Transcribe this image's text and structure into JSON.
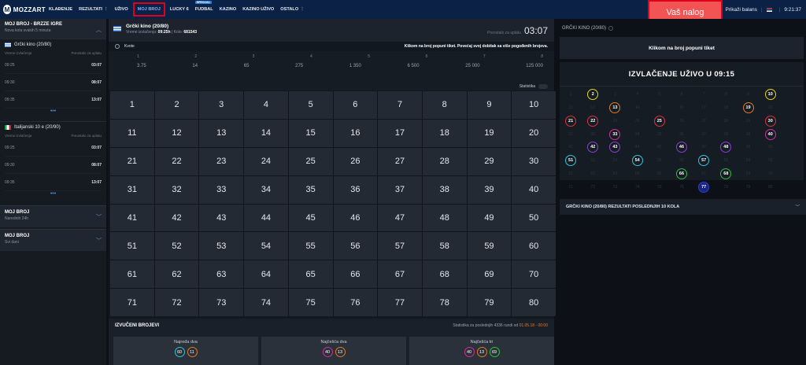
{
  "logo": {
    "text": "MOZZART"
  },
  "nav": [
    {
      "label": "KLAĐENJE",
      "dots": false
    },
    {
      "label": "REZULTATI",
      "dots": true
    },
    {
      "label": "UŽIVO",
      "dots": false
    },
    {
      "label": "MOJ BROJ",
      "dots": false,
      "active": true
    },
    {
      "label": "LUCKY 6",
      "dots": false
    },
    {
      "label": "FUDBAL",
      "dots": false,
      "badge": "SPECIJAL"
    },
    {
      "label": "KAZINO",
      "dots": false
    },
    {
      "label": "KAZINO UŽIVO",
      "dots": false
    },
    {
      "label": "OSTALO",
      "dots": true
    }
  ],
  "account": {
    "label": "Vaš nalog"
  },
  "topright": {
    "balance": "Prikaži balans",
    "time": "9:21:37"
  },
  "left": {
    "header": {
      "title": "MOJ BROJ - BRZZE IGRE",
      "sub": "Nova kola svakih 5 minuta"
    },
    "greek": {
      "title": "Grčki kino (20/80)",
      "col1": "Vreme izvlačenja",
      "col2": "Preostalo za uplatu",
      "rows": [
        {
          "time": "09:25",
          "rem": "03:07"
        },
        {
          "time": "09:30",
          "rem": "08:07"
        },
        {
          "time": "09:35",
          "rem": "13:07"
        }
      ]
    },
    "italy": {
      "title": "Italijanski 10 e (20/90)",
      "col1": "Vreme izvlačenja",
      "col2": "Preostalo za uplatu",
      "rows": [
        {
          "time": "09:25",
          "rem": "03:07"
        },
        {
          "time": "09:30",
          "rem": "08:07"
        },
        {
          "time": "09:35",
          "rem": "13:07"
        }
      ]
    },
    "cats": [
      {
        "title": "MOJ BROJ",
        "sub": "Narednih 24h"
      },
      {
        "title": "MOJ BROJ",
        "sub": "Svi dani"
      }
    ]
  },
  "center": {
    "game": "Grčki kino (20/80)",
    "draw_time_label": "Vreme izvlačenja:",
    "draw_time": "09:25h",
    "round_label": "Kolo:",
    "round": "681543",
    "remaining_label": "Preostalo za uplatu",
    "remaining": "03:07",
    "kvote": "Kvote",
    "message": "Klikom na broj popuni tiket. Povećaj svoj dobitak sa više pogođenih brojeva.",
    "odds_n": [
      "1",
      "2",
      "3",
      "4",
      "5",
      "6",
      "7",
      "8"
    ],
    "odds_v": [
      "3.75",
      "14",
      "65",
      "275",
      "1 350",
      "6 500",
      "25 000",
      "125 000"
    ],
    "statistika": "Statistika",
    "drawn": {
      "title": "IZVUČENI BROJEVI",
      "stat_text": "Statistika za poslednjih 4336 rundi od",
      "stat_date": "01.05.18 - 00:00",
      "boxes": [
        {
          "title": "Najređa dva",
          "balls": [
            {
              "n": "60",
              "c": "#2ec4d6"
            },
            {
              "n": "11",
              "c": "#e07a22"
            }
          ]
        },
        {
          "title": "Najčešća dva",
          "balls": [
            {
              "n": "40",
              "c": "#d12e9a"
            },
            {
              "n": "13",
              "c": "#e07a22"
            }
          ]
        },
        {
          "title": "Najčešća tri",
          "balls": [
            {
              "n": "40",
              "c": "#d12e9a"
            },
            {
              "n": "13",
              "c": "#e07a22"
            },
            {
              "n": "69",
              "c": "#2fbf3c"
            }
          ]
        }
      ]
    }
  },
  "right": {
    "header": "GRČKI KINO (20/80)",
    "button": "Klikom na broj popuni tiket",
    "live_title": "IZVLAČENJE UŽIVO U 09:15",
    "last10": "GRČKI KINO (20/80) REZULTATI POSLEDNJIH 10 KOLA",
    "drawn": [
      {
        "n": 2,
        "c": "#e8d21d"
      },
      {
        "n": 10,
        "c": "#e8d21d"
      },
      {
        "n": 13,
        "c": "#e07a22"
      },
      {
        "n": 19,
        "c": "#e07a22"
      },
      {
        "n": 21,
        "c": "#e0303a"
      },
      {
        "n": 22,
        "c": "#e0303a"
      },
      {
        "n": 25,
        "c": "#e0303a"
      },
      {
        "n": 30,
        "c": "#e0303a"
      },
      {
        "n": 33,
        "c": "#d12e9a"
      },
      {
        "n": 40,
        "c": "#d12e9a"
      },
      {
        "n": 42,
        "c": "#8a3fd1"
      },
      {
        "n": 43,
        "c": "#8a3fd1"
      },
      {
        "n": 46,
        "c": "#8a3fd1"
      },
      {
        "n": 48,
        "c": "#8a3fd1"
      },
      {
        "n": 51,
        "c": "#2ec4d6"
      },
      {
        "n": 54,
        "c": "#2ec4d6"
      },
      {
        "n": 57,
        "c": "#2ec4d6"
      },
      {
        "n": 66,
        "c": "#2fbf3c"
      },
      {
        "n": 68,
        "c": "#2fbf3c"
      },
      {
        "n": 77,
        "c": "#2a3fd6"
      }
    ]
  }
}
